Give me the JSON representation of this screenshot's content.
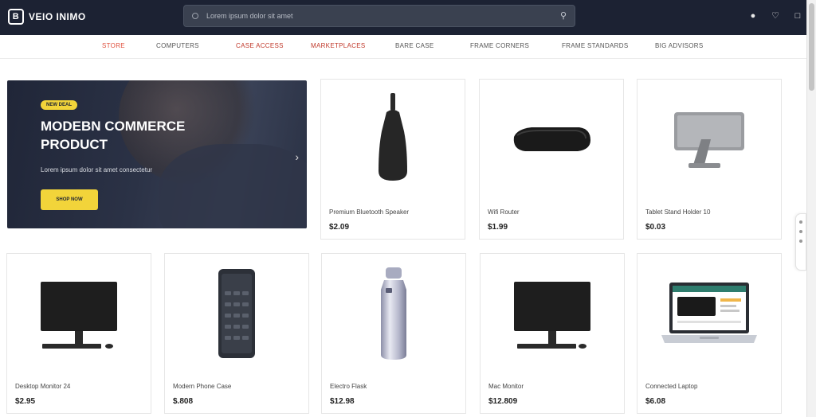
{
  "brand": {
    "logo_glyph": "B",
    "name": "VEIO INIMO",
    "accent_suffix": ""
  },
  "search": {
    "placeholder": "Lorem ipsum dolor sit amet",
    "icon": "search-icon"
  },
  "top_icons": [
    "user-icon",
    "heart-icon",
    "cart-icon"
  ],
  "nav": [
    {
      "label": "STORE",
      "active": true
    },
    {
      "label": "COMPUTERS",
      "active": false
    },
    {
      "label": "CASE ACCESS",
      "active": false,
      "accent": true
    },
    {
      "label": "MARKETPLACES",
      "active": false,
      "accent": true
    },
    {
      "label": "BARE CASE",
      "active": false
    },
    {
      "label": "FRAME CORNERS",
      "active": false
    },
    {
      "label": "FRAME STANDARDS",
      "active": false
    },
    {
      "label": "BIG ADVISORS",
      "active": false
    }
  ],
  "hero": {
    "badge": "NEW DEAL",
    "title": "MODEBN COMMERCE PRODUCT",
    "subtitle": "Lorem ipsum dolor sit amet consectetur",
    "cta": "SHOP NOW",
    "arrow": "›"
  },
  "products": [
    {
      "name": "Premium Bluetooth Speaker",
      "price": "$2.09",
      "kind": "bottle-dark"
    },
    {
      "name": "Wifi Router",
      "price": "$1.99",
      "kind": "router"
    },
    {
      "name": "Tablet Stand Holder 10",
      "price": "$0.03",
      "kind": "tablet-stand"
    },
    {
      "name": "Desktop Monitor 24",
      "price": "$2.95",
      "kind": "monitor"
    },
    {
      "name": "Modern Phone Case",
      "price": "$.808",
      "kind": "phone"
    },
    {
      "name": "Electro Flask",
      "price": "$12.98",
      "kind": "flask"
    },
    {
      "name": "Mac Monitor",
      "price": "$12.809",
      "kind": "monitor"
    },
    {
      "name": "Connected Laptop",
      "price": "$6.08",
      "kind": "laptop"
    }
  ],
  "colors": {
    "topbar": "#1c2233",
    "accent": "#f2d43a",
    "nav_active": "#e0503d"
  }
}
